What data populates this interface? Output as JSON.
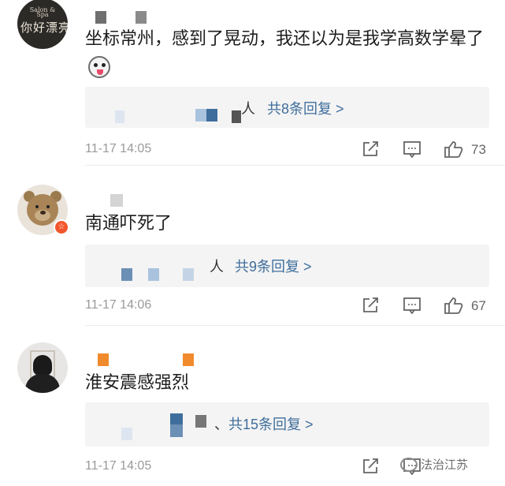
{
  "comments": [
    {
      "avatar_text_top": "Salon & Spa",
      "avatar_text": "你好漂亮",
      "text": "坐标常州，感到了晃动，我还以为是我学高数学晕了",
      "reply_suffix": "人",
      "reply_count_label": "共8条回复 >",
      "time": "11-17 14:05",
      "likes": "73"
    },
    {
      "badge": "☆",
      "text": "南通吓死了",
      "reply_suffix": "人",
      "reply_count_label": "共9条回复 >",
      "time": "11-17 14:06",
      "likes": "67"
    },
    {
      "text": "淮安震感强烈",
      "reply_suffix": "、",
      "reply_count_label": "共15条回复 >",
      "time": "11-17 14:05",
      "likes": ""
    }
  ],
  "icons": {
    "share": "share-icon",
    "comment": "comment-icon",
    "like": "thumbs-up-icon"
  },
  "watermark": {
    "text": "法治江苏"
  },
  "colors": {
    "link": "#3f6e9c",
    "reply_bg": "#f4f4f4",
    "meta": "#9a9a9a"
  }
}
